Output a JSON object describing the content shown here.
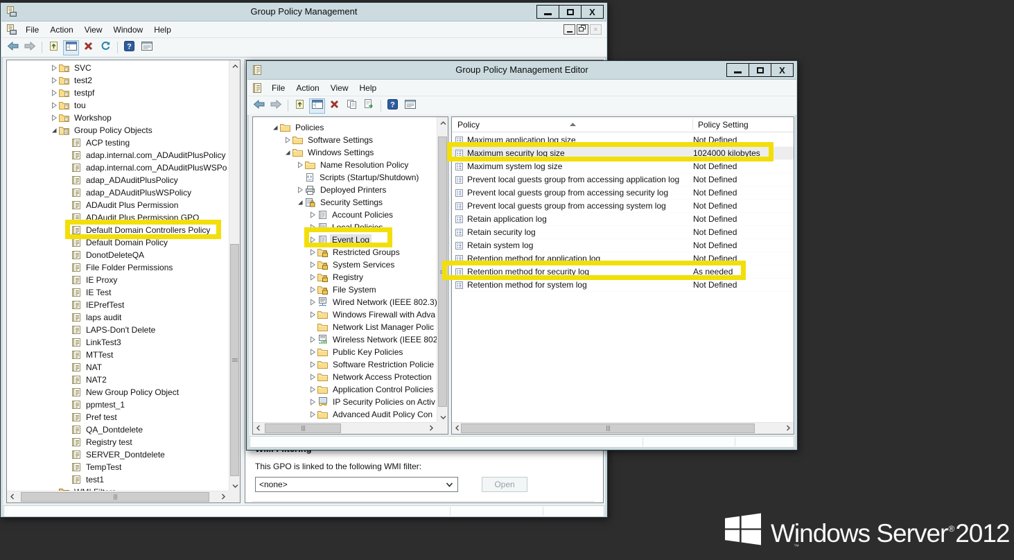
{
  "desktop": {
    "background": "#2d2d2d",
    "logo": {
      "brand": "Windows Server",
      "registered": "®",
      "year": "2012",
      "tm": "™"
    }
  },
  "highlight_color": "#F2DF0A",
  "main_window": {
    "title": "Group Policy Management",
    "menu": [
      "File",
      "Action",
      "View",
      "Window",
      "Help"
    ],
    "toolbar": [
      "back",
      "forward",
      "separator",
      "up-doc",
      "console-window",
      "delete-x",
      "refresh",
      "separator",
      "help",
      "export-list"
    ],
    "tree": {
      "items": [
        {
          "label": "SVC",
          "depth": 3,
          "expander": "collapsed",
          "icon": "ou-folder"
        },
        {
          "label": "test2",
          "depth": 3,
          "expander": "collapsed",
          "icon": "ou-folder"
        },
        {
          "label": "testpf",
          "depth": 3,
          "expander": "collapsed",
          "icon": "ou-folder"
        },
        {
          "label": "tou",
          "depth": 3,
          "expander": "collapsed",
          "icon": "ou-folder"
        },
        {
          "label": "Workshop",
          "depth": 3,
          "expander": "collapsed",
          "icon": "ou-folder"
        },
        {
          "label": "Group Policy Objects",
          "depth": 3,
          "expander": "expanded",
          "icon": "gpo-container"
        },
        {
          "label": "ACP testing",
          "depth": 4,
          "expander": "none",
          "icon": "gpo-scroll"
        },
        {
          "label": "adap.internal.com_ADAuditPlusPolicy",
          "depth": 4,
          "expander": "none",
          "icon": "gpo-scroll"
        },
        {
          "label": "adap.internal.com_ADAuditPlusWSPo",
          "depth": 4,
          "expander": "none",
          "icon": "gpo-scroll"
        },
        {
          "label": "adap_ADAuditPlusPolicy",
          "depth": 4,
          "expander": "none",
          "icon": "gpo-scroll"
        },
        {
          "label": "adap_ADAuditPlusWSPolicy",
          "depth": 4,
          "expander": "none",
          "icon": "gpo-scroll"
        },
        {
          "label": "ADAudit Plus Permission",
          "depth": 4,
          "expander": "none",
          "icon": "gpo-scroll"
        },
        {
          "label": "ADAudit Plus Permission GPO",
          "depth": 4,
          "expander": "none",
          "icon": "gpo-scroll"
        },
        {
          "label": "Default Domain Controllers Policy",
          "depth": 4,
          "expander": "none",
          "icon": "gpo-scroll",
          "highlighted": true
        },
        {
          "label": "Default Domain Policy",
          "depth": 4,
          "expander": "none",
          "icon": "gpo-scroll"
        },
        {
          "label": "DonotDeleteQA",
          "depth": 4,
          "expander": "none",
          "icon": "gpo-scroll"
        },
        {
          "label": "File Folder Permissions",
          "depth": 4,
          "expander": "none",
          "icon": "gpo-scroll"
        },
        {
          "label": "IE Proxy",
          "depth": 4,
          "expander": "none",
          "icon": "gpo-scroll"
        },
        {
          "label": "IE Test",
          "depth": 4,
          "expander": "none",
          "icon": "gpo-scroll"
        },
        {
          "label": "IEPrefTest",
          "depth": 4,
          "expander": "none",
          "icon": "gpo-scroll"
        },
        {
          "label": "laps audit",
          "depth": 4,
          "expander": "none",
          "icon": "gpo-scroll"
        },
        {
          "label": "LAPS-Don't Delete",
          "depth": 4,
          "expander": "none",
          "icon": "gpo-scroll"
        },
        {
          "label": "LinkTest3",
          "depth": 4,
          "expander": "none",
          "icon": "gpo-scroll"
        },
        {
          "label": "MTTest",
          "depth": 4,
          "expander": "none",
          "icon": "gpo-scroll"
        },
        {
          "label": "NAT",
          "depth": 4,
          "expander": "none",
          "icon": "gpo-scroll"
        },
        {
          "label": "NAT2",
          "depth": 4,
          "expander": "none",
          "icon": "gpo-scroll"
        },
        {
          "label": "New Group Policy Object",
          "depth": 4,
          "expander": "none",
          "icon": "gpo-scroll"
        },
        {
          "label": "ppmtest_1",
          "depth": 4,
          "expander": "none",
          "icon": "gpo-scroll"
        },
        {
          "label": "Pref test",
          "depth": 4,
          "expander": "none",
          "icon": "gpo-scroll"
        },
        {
          "label": "QA_Dontdelete",
          "depth": 4,
          "expander": "none",
          "icon": "gpo-scroll"
        },
        {
          "label": "Registry test",
          "depth": 4,
          "expander": "none",
          "icon": "gpo-scroll"
        },
        {
          "label": "SERVER_Dontdelete",
          "depth": 4,
          "expander": "none",
          "icon": "gpo-scroll"
        },
        {
          "label": "TempTest",
          "depth": 4,
          "expander": "none",
          "icon": "gpo-scroll"
        },
        {
          "label": "test1",
          "depth": 4,
          "expander": "none",
          "icon": "gpo-scroll"
        },
        {
          "label": "WMI Filters",
          "depth": 3,
          "expander": "none",
          "icon": "wmi-folder"
        }
      ]
    },
    "wmi": {
      "heading": "WMI Filtering",
      "label": "This GPO is linked to the following WMI filter:",
      "combo_value": "<none>",
      "open_button": "Open"
    }
  },
  "editor_window": {
    "title": "Group Policy Management Editor",
    "menu": [
      "File",
      "Action",
      "View",
      "Help"
    ],
    "toolbar": [
      "back",
      "forward",
      "separator",
      "up-doc",
      "console-window",
      "delete-x",
      "copy",
      "export-doc",
      "separator",
      "help",
      "export-list"
    ],
    "tree": {
      "items": [
        {
          "label": "Policies",
          "depth": 1,
          "expander": "expanded",
          "icon": "folder"
        },
        {
          "label": "Software Settings",
          "depth": 2,
          "expander": "collapsed",
          "icon": "folder"
        },
        {
          "label": "Windows Settings",
          "depth": 2,
          "expander": "expanded",
          "icon": "folder"
        },
        {
          "label": "Name Resolution Policy",
          "depth": 3,
          "expander": "collapsed",
          "icon": "folder"
        },
        {
          "label": "Scripts (Startup/Shutdown)",
          "depth": 3,
          "expander": "none",
          "icon": "scripts"
        },
        {
          "label": "Deployed Printers",
          "depth": 3,
          "expander": "collapsed",
          "icon": "printer"
        },
        {
          "label": "Security Settings",
          "depth": 3,
          "expander": "expanded",
          "icon": "security-settings"
        },
        {
          "label": "Account Policies",
          "depth": 4,
          "expander": "collapsed",
          "icon": "policy-group"
        },
        {
          "label": "Local Policies",
          "depth": 4,
          "expander": "collapsed",
          "icon": "policy-group"
        },
        {
          "label": "Event Log",
          "depth": 4,
          "expander": "collapsed",
          "icon": "policy-group",
          "selected": true,
          "highlighted": true
        },
        {
          "label": "Restricted Groups",
          "depth": 4,
          "expander": "collapsed",
          "icon": "locked-folder"
        },
        {
          "label": "System Services",
          "depth": 4,
          "expander": "collapsed",
          "icon": "locked-folder"
        },
        {
          "label": "Registry",
          "depth": 4,
          "expander": "collapsed",
          "icon": "locked-folder"
        },
        {
          "label": "File System",
          "depth": 4,
          "expander": "collapsed",
          "icon": "locked-folder"
        },
        {
          "label": "Wired Network (IEEE 802.3)",
          "depth": 4,
          "expander": "collapsed",
          "icon": "wired-network"
        },
        {
          "label": "Windows Firewall with Adva",
          "depth": 4,
          "expander": "collapsed",
          "icon": "folder"
        },
        {
          "label": "Network List Manager Polic",
          "depth": 4,
          "expander": "none",
          "icon": "folder"
        },
        {
          "label": "Wireless Network (IEEE 802.",
          "depth": 4,
          "expander": "collapsed",
          "icon": "wireless-network"
        },
        {
          "label": "Public Key Policies",
          "depth": 4,
          "expander": "collapsed",
          "icon": "folder"
        },
        {
          "label": "Software Restriction Policie",
          "depth": 4,
          "expander": "collapsed",
          "icon": "folder"
        },
        {
          "label": "Network Access Protection",
          "depth": 4,
          "expander": "collapsed",
          "icon": "folder"
        },
        {
          "label": "Application Control Policies",
          "depth": 4,
          "expander": "collapsed",
          "icon": "folder"
        },
        {
          "label": "IP Security Policies on Activ",
          "depth": 4,
          "expander": "collapsed",
          "icon": "ip-security"
        },
        {
          "label": "Advanced Audit Policy Con",
          "depth": 4,
          "expander": "collapsed",
          "icon": "folder"
        }
      ]
    },
    "list": {
      "columns": [
        "Policy",
        "Policy Setting"
      ],
      "sort": "ascending",
      "rows": [
        {
          "policy": "Maximum application log size",
          "setting": "Not Defined"
        },
        {
          "policy": "Maximum security log size",
          "setting": "1024000 kilobytes",
          "selected": true,
          "highlighted": true
        },
        {
          "policy": "Maximum system log size",
          "setting": "Not Defined"
        },
        {
          "policy": "Prevent local guests group from accessing application log",
          "setting": "Not Defined"
        },
        {
          "policy": "Prevent local guests group from accessing security log",
          "setting": "Not Defined"
        },
        {
          "policy": "Prevent local guests group from accessing system log",
          "setting": "Not Defined"
        },
        {
          "policy": "Retain application log",
          "setting": "Not Defined"
        },
        {
          "policy": "Retain security log",
          "setting": "Not Defined"
        },
        {
          "policy": "Retain system log",
          "setting": "Not Defined"
        },
        {
          "policy": "Retention method for application log",
          "setting": "Not Defined"
        },
        {
          "policy": "Retention method for security log",
          "setting": "As needed",
          "highlighted": true
        },
        {
          "policy": "Retention method for system log",
          "setting": "Not Defined"
        }
      ]
    }
  }
}
